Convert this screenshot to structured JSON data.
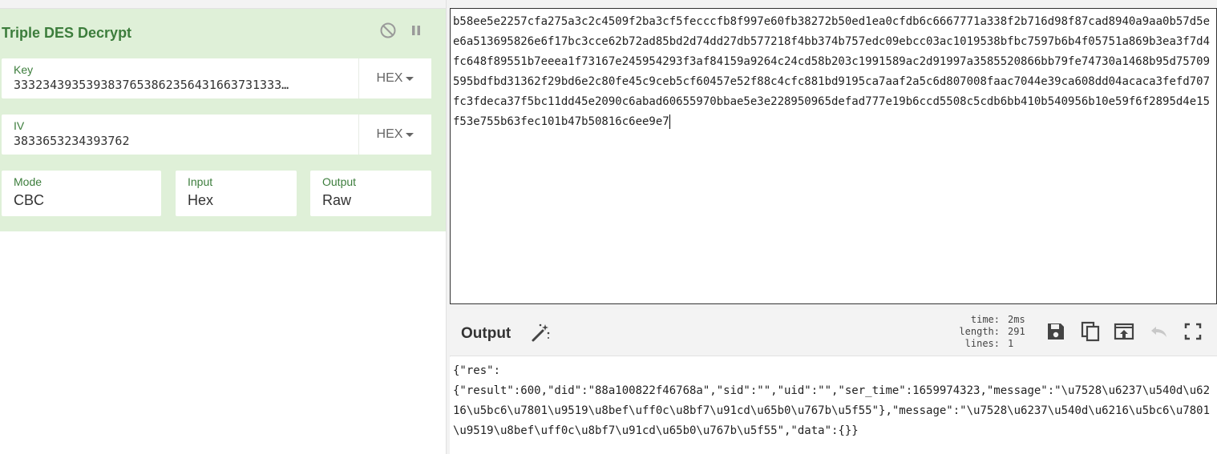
{
  "recipe": {
    "operation": {
      "title": "Triple DES Decrypt",
      "key": {
        "label": "Key",
        "value": "3332343935393837653862356431663731333…",
        "format": "HEX"
      },
      "iv": {
        "label": "IV",
        "value": "3833653234393762",
        "format": "HEX"
      },
      "mode": {
        "label": "Mode",
        "value": "CBC"
      },
      "input": {
        "label": "Input",
        "value": "Hex"
      },
      "output": {
        "label": "Output",
        "value": "Raw"
      }
    }
  },
  "input": {
    "text": "b58ee5e2257cfa275a3c2c4509f2ba3cf5fecccfb8f997e60fb38272b50ed1ea0cfdb6c6667771a338f2b716d98f87cad8940a9aa0b57d5ee6a513695826e6f17bc3cce62b72ad85bd2d74dd27db577218f4bb374b757edc09ebcc03ac1019538bfbc7597b6b4f05751a869b3ea3f7d4fc648f89551b7eeea1f73167e245954293f3af84159a9264c24cd58b203c1991589ac2d91997a3585520866bb79fe74730a1468b95d75709595bdfbd31362f29bd6e2c80fe45c9ceb5cf60457e52f88c4cfc881bd9195ca7aaf2a5c6d807008faac7044e39ca608dd04acaca3fefd707fc3fdeca37f5bc11dd45e2090c6abad60655970bbae5e3e228950965defad777e19b6ccd5508c5cdb6bb410b540956b10e59f6f2895d4e15f53e755b63fec101b47b50816c6ee9e7"
  },
  "output": {
    "title": "Output",
    "stats": {
      "time_label": "time:",
      "time_value": "2ms",
      "length_label": "length:",
      "length_value": "291",
      "lines_label": "lines:",
      "lines_value": "1"
    },
    "text": "{\"res\":\n{\"result\":600,\"did\":\"88a100822f46768a\",\"sid\":\"\",\"uid\":\"\",\"ser_time\":1659974323,\"message\":\"\\u7528\\u6237\\u540d\\u6216\\u5bc6\\u7801\\u9519\\u8bef\\uff0c\\u8bf7\\u91cd\\u65b0\\u767b\\u5f55\"},\"message\":\"\\u7528\\u6237\\u540d\\u6216\\u5bc6\\u7801\\u9519\\u8bef\\uff0c\\u8bf7\\u91cd\\u65b0\\u767b\\u5f55\",\"data\":{}}"
  },
  "icons": {
    "disable": "disable-icon",
    "pause": "pause-icon",
    "magic": "magic-wand-icon",
    "save": "save-icon",
    "copy": "copy-icon",
    "replace": "replace-input-icon",
    "undo": "undo-icon",
    "maximise": "maximise-icon"
  },
  "colors": {
    "operation_bg": "#dff0d8",
    "operation_text": "#3c7d3c"
  }
}
